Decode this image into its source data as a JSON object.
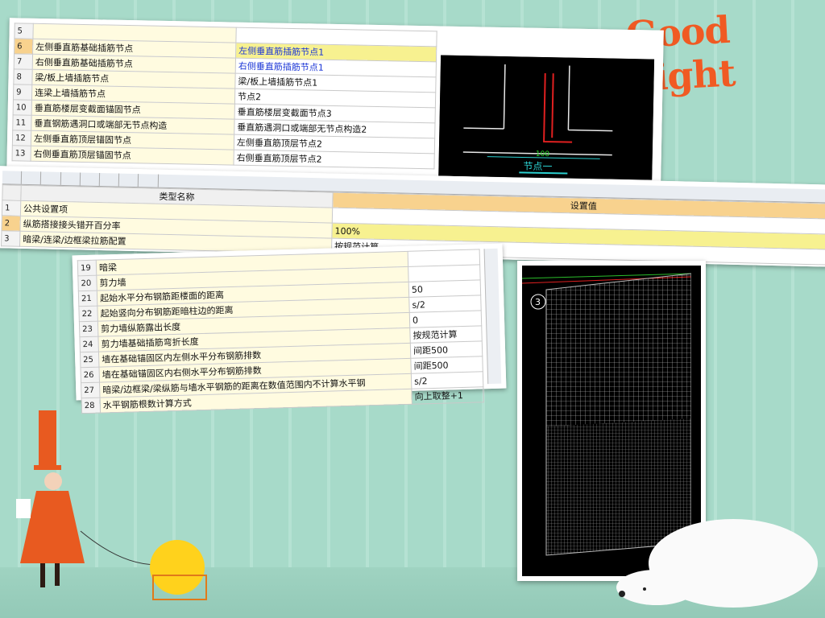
{
  "decor": {
    "greeting": "Good night"
  },
  "panel1": {
    "rows": [
      {
        "num": "5",
        "name": "",
        "value": "",
        "blue": false
      },
      {
        "num": "6",
        "name": "左侧垂直筋基础插筋节点",
        "value": "左侧垂直筋插筋节点1",
        "blue": true
      },
      {
        "num": "7",
        "name": "右侧垂直筋基础插筋节点",
        "value": "右侧垂直筋插筋节点1",
        "blue": true
      },
      {
        "num": "8",
        "name": "梁/板上墙插筋节点",
        "value": "梁/板上墙插筋节点1",
        "blue": false
      },
      {
        "num": "9",
        "name": "连梁上墙插筋节点",
        "value": "节点2",
        "blue": false
      },
      {
        "num": "10",
        "name": "垂直筋楼层变截面锚固节点",
        "value": "垂直筋楼层变截面节点3",
        "blue": false
      },
      {
        "num": "11",
        "name": "垂直钢筋遇洞口或端部无节点构造",
        "value": "垂直筋遇洞口或端部无节点构造2",
        "blue": false
      },
      {
        "num": "12",
        "name": "左侧垂直筋顶层锚固节点",
        "value": "左侧垂直筋顶层节点2",
        "blue": false
      },
      {
        "num": "13",
        "name": "右侧垂直筋顶层锚固节点",
        "value": "右侧垂直筋顶层节点2",
        "blue": false
      }
    ],
    "cad": {
      "dimension": "100",
      "caption": "节点一"
    }
  },
  "panel2": {
    "col_name": "类型名称",
    "col_value": "设置值",
    "rows": [
      {
        "num": "1",
        "name": "公共设置项",
        "value": ""
      },
      {
        "num": "2",
        "name": "纵筋搭接接头错开百分率",
        "value": "100%"
      },
      {
        "num": "3",
        "name": "暗梁/连梁/边框梁拉筋配置",
        "value": "按规范计算"
      }
    ]
  },
  "panel3": {
    "rows": [
      {
        "num": "19",
        "name": "暗梁",
        "value": ""
      },
      {
        "num": "20",
        "name": "剪力墙",
        "value": ""
      },
      {
        "num": "21",
        "name": "起始水平分布钢筋距楼面的距离",
        "value": "50"
      },
      {
        "num": "22",
        "name": "起始竖向分布钢筋距暗柱边的距离",
        "value": "s/2"
      },
      {
        "num": "23",
        "name": "剪力墙纵筋露出长度",
        "value": "0"
      },
      {
        "num": "24",
        "name": "剪力墙基础插筋弯折长度",
        "value": "按规范计算"
      },
      {
        "num": "25",
        "name": "墙在基础锚固区内左侧水平分布钢筋排数",
        "value": "间距500"
      },
      {
        "num": "26",
        "name": "墙在基础锚固区内右侧水平分布钢筋排数",
        "value": "间距500"
      },
      {
        "num": "27",
        "name": "暗梁/边框梁/梁纵筋与墙水平钢筋的距离在数值范围内不计算水平钢",
        "value": "s/2"
      },
      {
        "num": "28",
        "name": "水平钢筋根数计算方式",
        "value": "向上取整+1"
      }
    ]
  },
  "panel4": {
    "marker": "3"
  }
}
